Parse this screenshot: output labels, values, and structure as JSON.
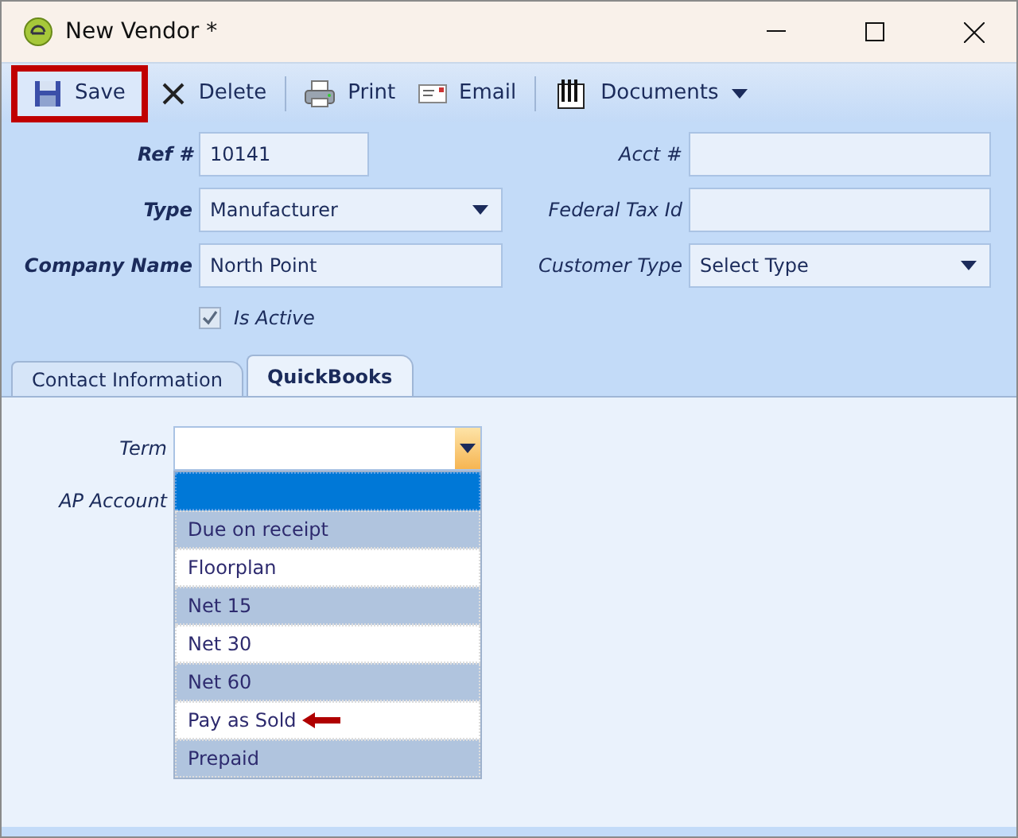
{
  "window": {
    "title": "New Vendor *"
  },
  "toolbar": [
    {
      "kind": "save",
      "label": "Save",
      "highlighted": true
    },
    {
      "kind": "delete",
      "label": "Delete",
      "highlighted": false
    },
    {
      "kind": "print",
      "label": "Print",
      "highlighted": false
    },
    {
      "kind": "email",
      "label": "Email",
      "highlighted": false
    },
    {
      "kind": "documents",
      "label": "Documents",
      "highlighted": false
    }
  ],
  "form": {
    "left": [
      {
        "label": "Ref #",
        "value": "10141",
        "kind": "text"
      },
      {
        "label": "Type",
        "value": "Manufacturer",
        "kind": "dropdown"
      },
      {
        "label": "Company Name",
        "value": "North Point",
        "kind": "text"
      }
    ],
    "right": [
      {
        "label": "Acct #",
        "kind": "text"
      },
      {
        "label": "Federal Tax Id",
        "kind": "text"
      },
      {
        "label": "Customer Type",
        "value": "Select Type",
        "kind": "dropdown"
      }
    ],
    "is_active": {
      "label": "Is Active",
      "checked": true
    }
  },
  "tabs": [
    {
      "label": "Contact Information",
      "selected": false
    },
    {
      "label": "QuickBooks",
      "selected": true
    }
  ],
  "quickbooks": {
    "term_label": "Term",
    "ap_account_label": "AP Account",
    "term_options": [
      {
        "selected": true,
        "marked": false
      },
      {
        "label": "Due on receipt",
        "selected": false,
        "marked": false
      },
      {
        "label": "Floorplan",
        "selected": false,
        "marked": false
      },
      {
        "label": "Net 15",
        "selected": false,
        "marked": false
      },
      {
        "label": "Net 30",
        "selected": false,
        "marked": false
      },
      {
        "label": "Net 60",
        "selected": false,
        "marked": false
      },
      {
        "label": "Pay as Sold",
        "selected": false,
        "marked": true
      },
      {
        "label": "Prepaid",
        "selected": false,
        "marked": false
      }
    ]
  }
}
